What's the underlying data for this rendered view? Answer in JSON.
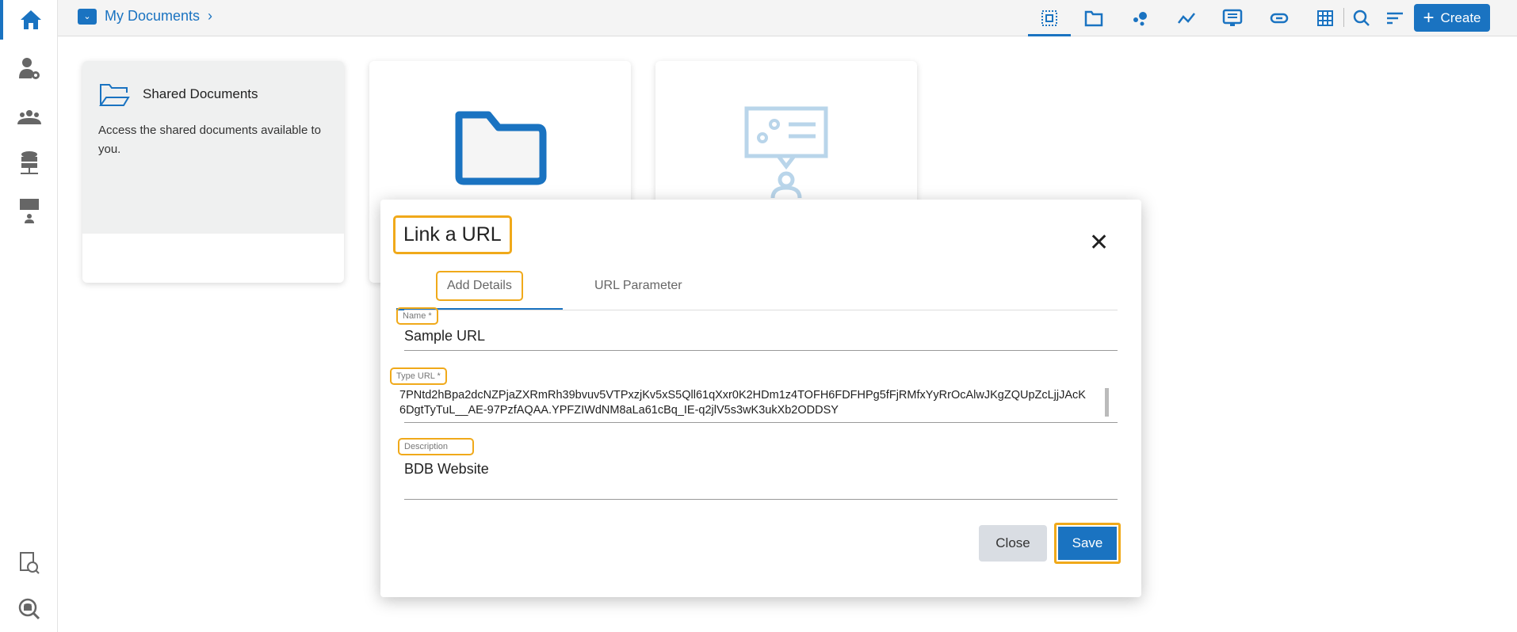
{
  "header": {
    "breadcrumb": "My Documents",
    "breadcrumb_sep": "›",
    "create_label": "Create"
  },
  "cards": [
    {
      "title": "Shared Documents",
      "description": "Access the shared documents available to you."
    }
  ],
  "modal": {
    "title": "Link a URL",
    "tabs": [
      {
        "label": "Add Details",
        "active": true
      },
      {
        "label": "URL Parameter",
        "active": false
      }
    ],
    "fields": {
      "name": {
        "label": "Name *",
        "value": "Sample URL"
      },
      "url": {
        "label": "Type URL *",
        "value": "7PNtd2hBpa2dcNZPjaZXRmRh39bvuv5VTPxzjKv5xS5Qll61qXxr0K2HDm1z4TOFH6FDFHPg5fFjRMfxYyRrOcAlwJKgZQUpZcLjjJAcK6DgtTyTuL__AE-97PzfAQAA.YPFZIWdNM8aLa61cBq_IE-q2jlV5s3wK3ukXb2ODDSY"
      },
      "description": {
        "label": "Description",
        "value": "BDB Website"
      }
    },
    "close_label": "Close",
    "save_label": "Save"
  },
  "colors": {
    "accent": "#1a73c1",
    "highlight": "#f0a91a"
  }
}
